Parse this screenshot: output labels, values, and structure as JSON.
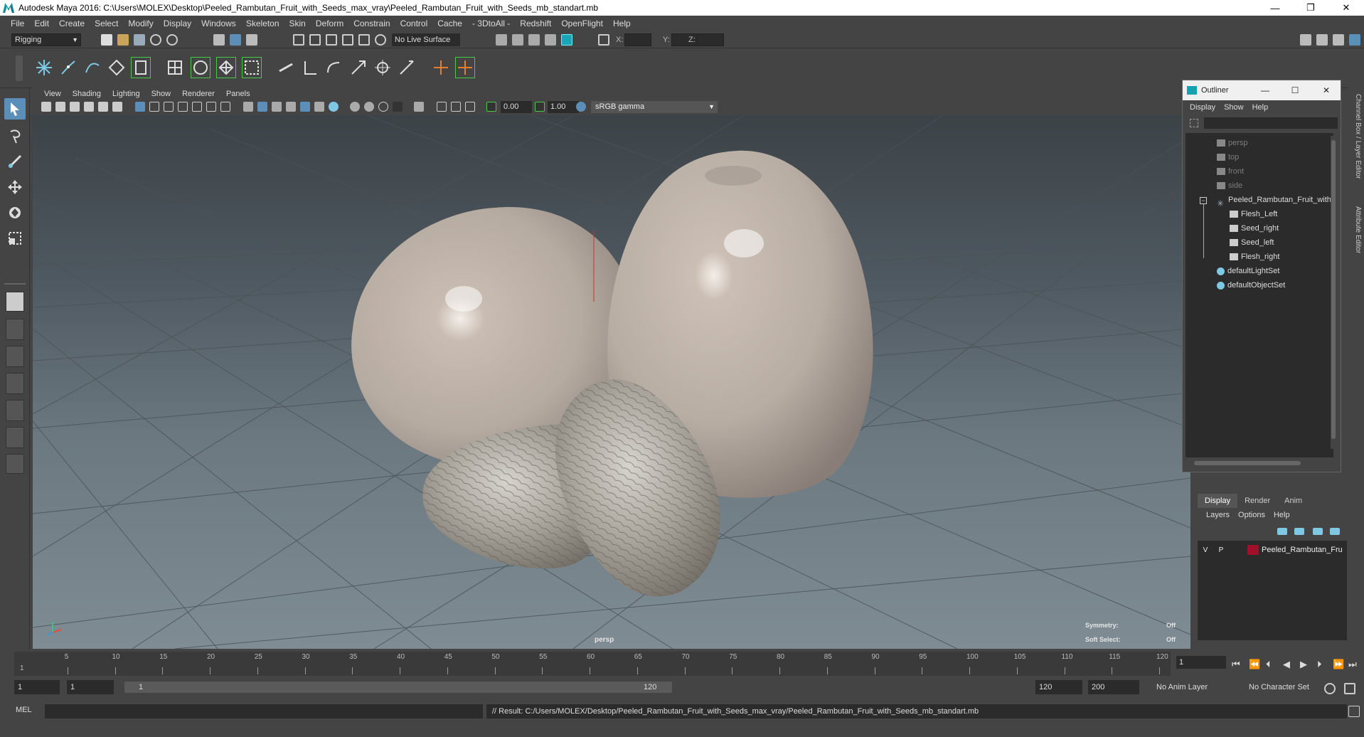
{
  "window": {
    "title": "Autodesk Maya 2016: C:\\Users\\MOLEX\\Desktop\\Peeled_Rambutan_Fruit_with_Seeds_max_vray\\Peeled_Rambutan_Fruit_with_Seeds_mb_standart.mb",
    "minimize": "—",
    "restore": "❐",
    "close": "✕"
  },
  "menubar": [
    "File",
    "Edit",
    "Create",
    "Select",
    "Modify",
    "Display",
    "Windows",
    "Skeleton",
    "Skin",
    "Deform",
    "Constrain",
    "Control",
    "Cache",
    "- 3DtoAll -",
    "Redshift",
    "OpenFlight",
    "Help"
  ],
  "statusline": {
    "mode": "Rigging",
    "live_surface": "No Live Surface",
    "x_label": "X:",
    "y_label": "Y:",
    "z_label": "Z:"
  },
  "panel": {
    "menus": [
      "View",
      "Shading",
      "Lighting",
      "Show",
      "Renderer",
      "Panels"
    ],
    "exposure": "0.00",
    "gamma": "1.00",
    "color_space": "sRGB gamma",
    "camera_label": "persp",
    "symmetry_label": "Symmetry:",
    "symmetry_value": "Off",
    "soft_select_label": "Soft Select:",
    "soft_select_value": "Off"
  },
  "outliner": {
    "title": "Outliner",
    "menus": [
      "Display",
      "Show",
      "Help"
    ],
    "items": [
      {
        "label": "persp",
        "dim": true,
        "icon": "camera-icon"
      },
      {
        "label": "top",
        "dim": true,
        "icon": "camera-icon"
      },
      {
        "label": "front",
        "dim": true,
        "icon": "camera-icon"
      },
      {
        "label": "side",
        "dim": true,
        "icon": "camera-icon"
      },
      {
        "label": "Peeled_Rambutan_Fruit_with",
        "dim": false,
        "icon": "group-icon"
      },
      {
        "label": "Flesh_Left",
        "dim": false,
        "icon": "mesh-icon"
      },
      {
        "label": "Seed_right",
        "dim": false,
        "icon": "mesh-icon"
      },
      {
        "label": "Seed_left",
        "dim": false,
        "icon": "mesh-icon"
      },
      {
        "label": "Flesh_right",
        "dim": false,
        "icon": "mesh-icon"
      },
      {
        "label": "defaultLightSet",
        "dim": false,
        "icon": "set-icon"
      },
      {
        "label": "defaultObjectSet",
        "dim": false,
        "icon": "set-icon"
      }
    ]
  },
  "right_dock": {
    "channel_tab": "Channel Box / Layer Editor",
    "attribute_tab": "Attribute Editor"
  },
  "layer_editor": {
    "tabs": [
      "Display",
      "Render",
      "Anim"
    ],
    "active_tab": "Display",
    "menus": [
      "Layers",
      "Options",
      "Help"
    ],
    "layer": {
      "v": "V",
      "p": "P",
      "name": "Peeled_Rambutan_Fru",
      "color": "#a0102a"
    }
  },
  "timeline": {
    "ticks": [
      "5",
      "10",
      "15",
      "20",
      "25",
      "30",
      "35",
      "40",
      "45",
      "50",
      "55",
      "60",
      "65",
      "70",
      "75",
      "80",
      "85",
      "90",
      "95",
      "100",
      "105",
      "110",
      "115",
      "120"
    ],
    "current_frame": "1",
    "start_marker": "1"
  },
  "range": {
    "start": "1",
    "anim_start": "1",
    "range_start_label": "1",
    "range_end_label": "120",
    "range_end": "120",
    "anim_end": "200",
    "anim_layer": "No Anim Layer",
    "character_set": "No Character Set"
  },
  "command": {
    "language": "MEL",
    "result": "// Result: C:/Users/MOLEX/Desktop/Peeled_Rambutan_Fruit_with_Seeds_max_vray/Peeled_Rambutan_Fruit_with_Seeds_mb_standart.mb"
  },
  "colors": {
    "accent": "#16a1b0",
    "layer_color": "#a0102a"
  }
}
